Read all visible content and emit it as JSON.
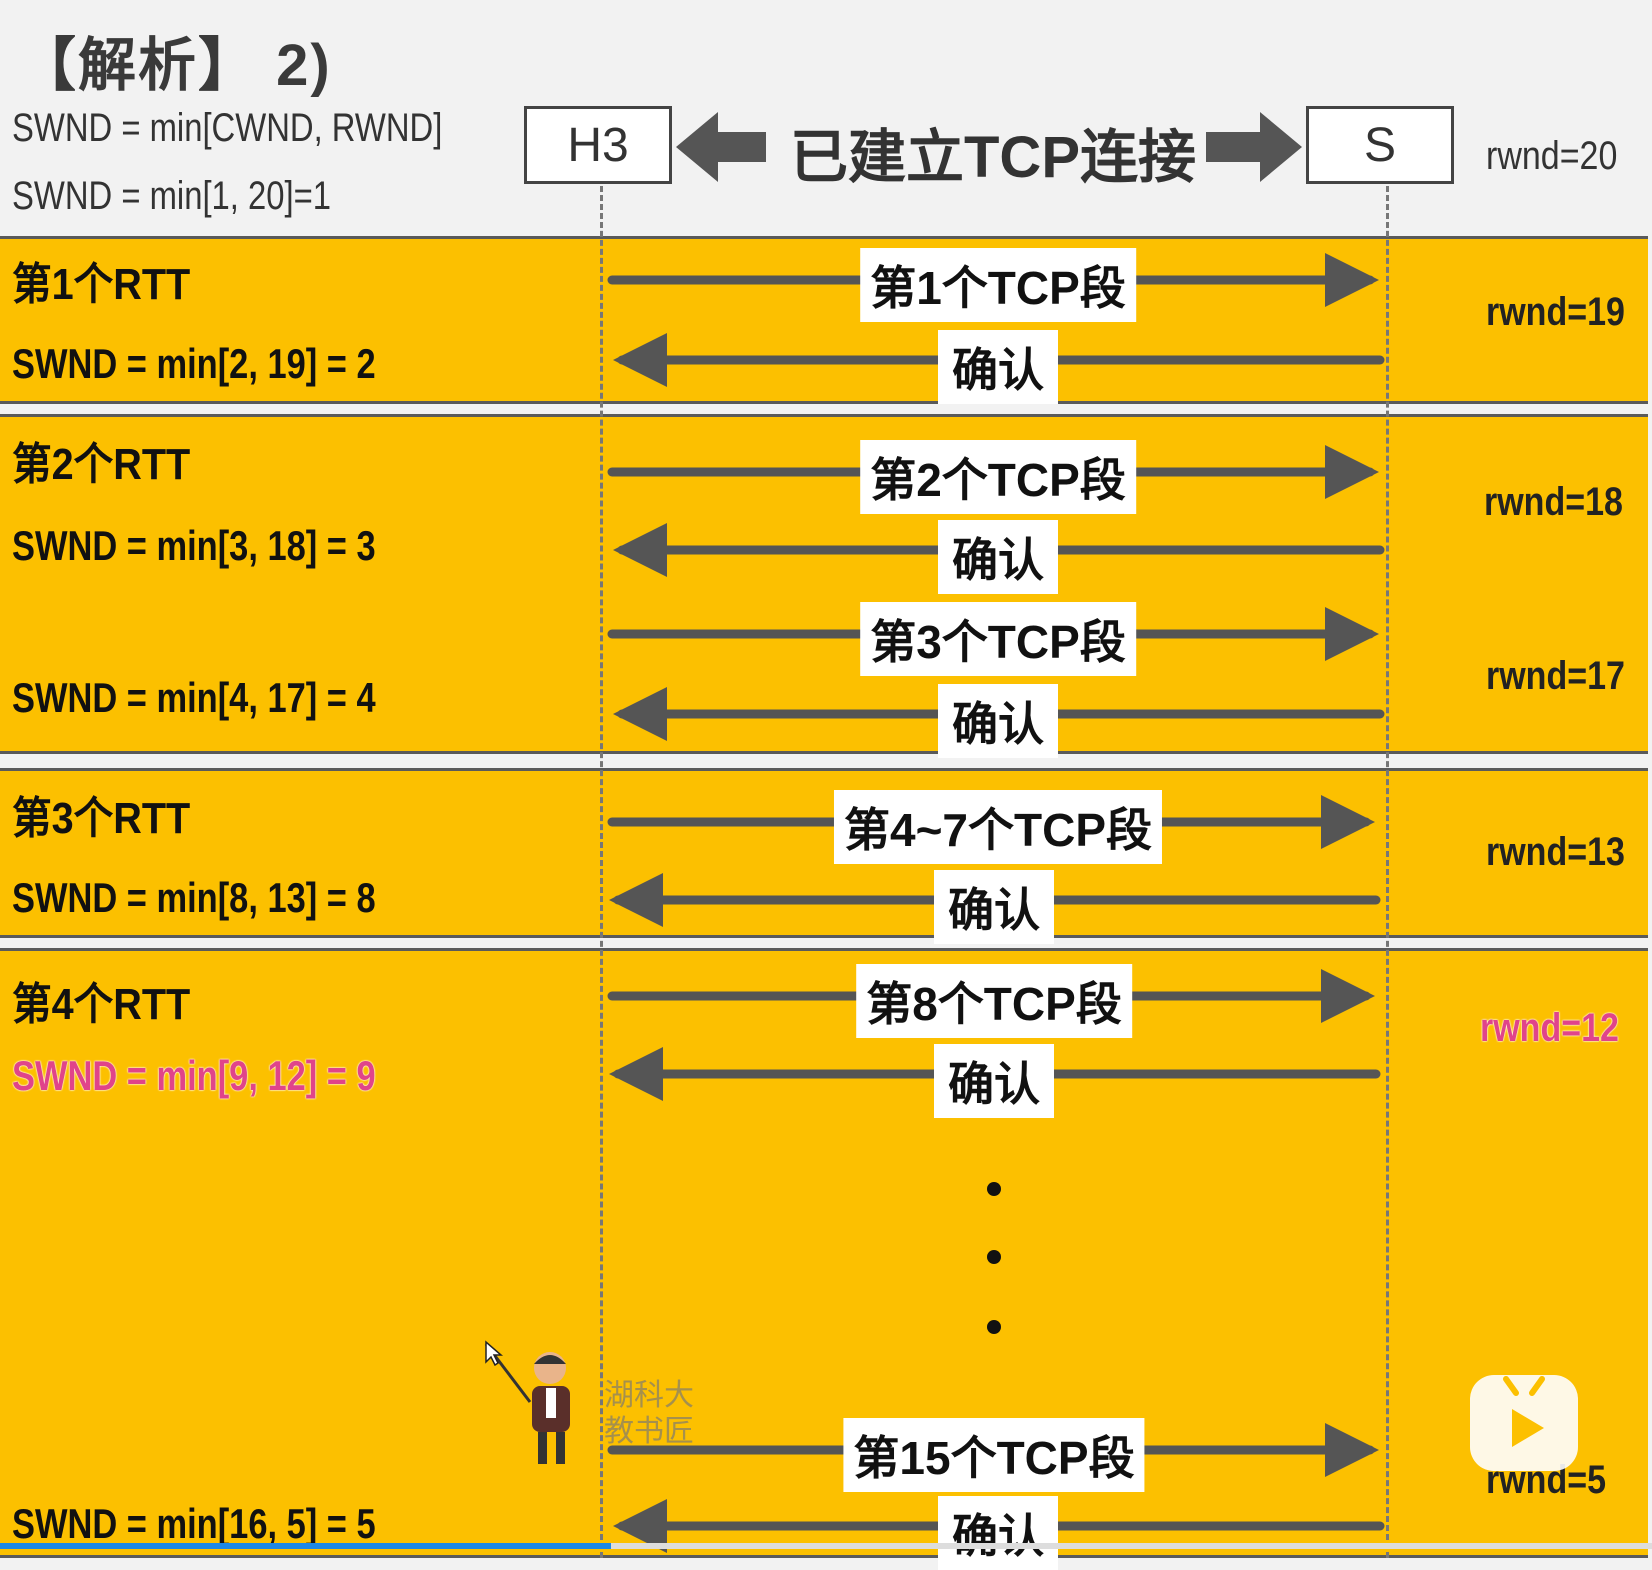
{
  "header": {
    "title": "【解析】 2)",
    "formula_1": "SWND = min[CWND, RWND]",
    "formula_2": "SWND = min[1, 20]=1",
    "host_left": "H3",
    "host_right": "S",
    "connection_label": "已建立TCP连接",
    "rwnd_initial": "rwnd=20"
  },
  "rtts": [
    {
      "label": "第1个RTT",
      "swnd": [
        "SWND = min[2, 19] = 2"
      ],
      "segments": [
        "第1个TCP段"
      ],
      "ack": "确认",
      "rwnd": [
        "rwnd=19"
      ]
    },
    {
      "label": "第2个RTT",
      "swnd": [
        "SWND = min[3, 18] = 3",
        "SWND = min[4, 17] = 4"
      ],
      "segments": [
        "第2个TCP段",
        "第3个TCP段"
      ],
      "ack": "确认",
      "rwnd": [
        "rwnd=18",
        "rwnd=17"
      ]
    },
    {
      "label": "第3个RTT",
      "swnd": [
        "SWND = min[8, 13] = 8"
      ],
      "segments": [
        "第4~7个TCP段"
      ],
      "ack": "确认",
      "rwnd": [
        "rwnd=13"
      ]
    },
    {
      "label": "第4个RTT",
      "swnd": [
        "SWND = min[9, 12] = 9",
        "SWND = min[16, 5] = 5"
      ],
      "segments": [
        "第8个TCP段",
        "第15个TCP段"
      ],
      "ack": "确认",
      "rwnd": [
        "rwnd=12",
        "rwnd=5"
      ]
    }
  ],
  "watermark": {
    "line1": "湖科大",
    "line2": "教书匠"
  },
  "video": {
    "progress": 0.37
  },
  "colors": {
    "band": "#fcc000",
    "arrow": "#555555",
    "highlight": "#e0448a"
  }
}
